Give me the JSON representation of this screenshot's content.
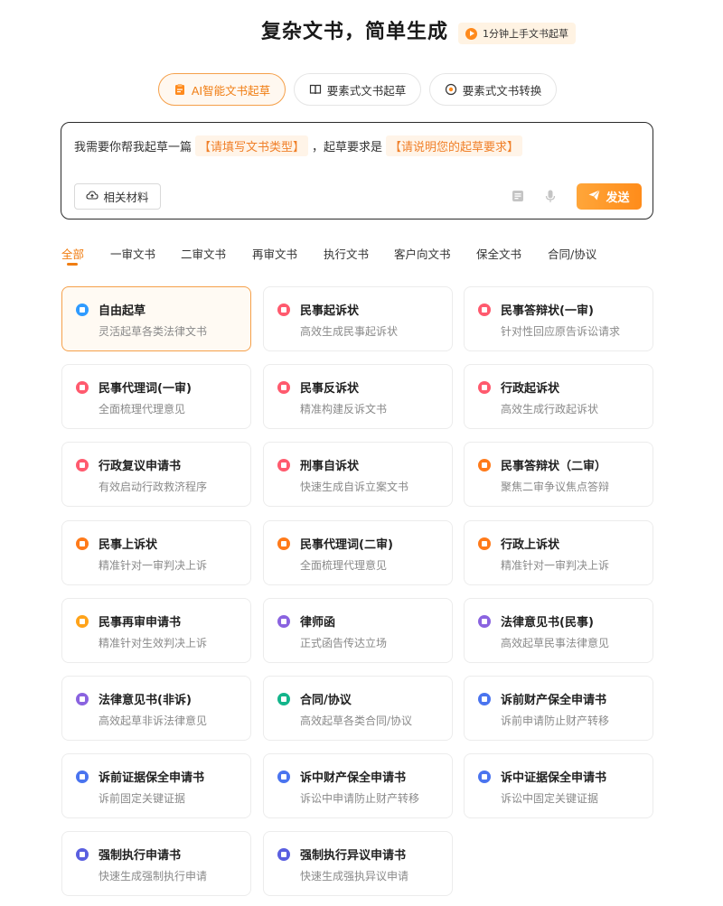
{
  "header": {
    "title": "复杂文书，简单生成",
    "tutorial_label": "1分钟上手文书起草",
    "tutorial_icon": "play-icon"
  },
  "modes": [
    {
      "label": "AI智能文书起草",
      "icon": "clipboard-icon",
      "active": true
    },
    {
      "label": "要素式文书起草",
      "icon": "book-icon",
      "active": false
    },
    {
      "label": "要素式文书转换",
      "icon": "convert-icon",
      "active": false
    }
  ],
  "composer": {
    "prefix": "我需要你帮我起草一篇",
    "doc_type_slot": "【请填写文书类型】",
    "middle": "，起草要求是",
    "requirement_slot": "【请说明您的起草要求】",
    "materials_label": "相关材料",
    "send_label": "发送"
  },
  "categories": [
    "全部",
    "一审文书",
    "二审文书",
    "再审文书",
    "执行文书",
    "客户向文书",
    "保全文书",
    "合同/协议"
  ],
  "cards": [
    {
      "title": "自由起草",
      "desc": "灵活起草各类法律文书",
      "icon_color": "#2f9bff"
    },
    {
      "title": "民事起诉状",
      "desc": "高效生成民事起诉状",
      "icon_color": "#ff5a6e"
    },
    {
      "title": "民事答辩状(一审)",
      "desc": "针对性回应原告诉讼请求",
      "icon_color": "#ff5a6e"
    },
    {
      "title": "民事代理词(一审)",
      "desc": "全面梳理代理意见",
      "icon_color": "#ff5a6e"
    },
    {
      "title": "民事反诉状",
      "desc": "精准构建反诉文书",
      "icon_color": "#ff5a6e"
    },
    {
      "title": "行政起诉状",
      "desc": "高效生成行政起诉状",
      "icon_color": "#ff5a6e"
    },
    {
      "title": "行政复议申请书",
      "desc": "有效启动行政救济程序",
      "icon_color": "#ff5a6e"
    },
    {
      "title": "刑事自诉状",
      "desc": "快速生成自诉立案文书",
      "icon_color": "#ff5a6e"
    },
    {
      "title": "民事答辩状（二审）",
      "desc": "聚焦二审争议焦点答辩",
      "icon_color": "#ff7a1a"
    },
    {
      "title": "民事上诉状",
      "desc": "精准针对一审判决上诉",
      "icon_color": "#ff7a1a"
    },
    {
      "title": "民事代理词(二审)",
      "desc": "全面梳理代理意见",
      "icon_color": "#ff7a1a"
    },
    {
      "title": "行政上诉状",
      "desc": "精准针对一审判决上诉",
      "icon_color": "#ff7a1a"
    },
    {
      "title": "民事再审申请书",
      "desc": "精准针对生效判决上诉",
      "icon_color": "#ffa31a"
    },
    {
      "title": "律师函",
      "desc": "正式函告传达立场",
      "icon_color": "#8a63e0"
    },
    {
      "title": "法律意见书(民事)",
      "desc": "高效起草民事法律意见",
      "icon_color": "#8a63e0"
    },
    {
      "title": "法律意见书(非诉)",
      "desc": "高效起草非诉法律意见",
      "icon_color": "#8a63e0"
    },
    {
      "title": "合同/协议",
      "desc": "高效起草各类合同/协议",
      "icon_color": "#13b58b"
    },
    {
      "title": "诉前财产保全申请书",
      "desc": "诉前申请防止财产转移",
      "icon_color": "#4a74ef"
    },
    {
      "title": "诉前证据保全申请书",
      "desc": "诉前固定关键证据",
      "icon_color": "#4a74ef"
    },
    {
      "title": "诉中财产保全申请书",
      "desc": "诉讼中申请防止财产转移",
      "icon_color": "#4a74ef"
    },
    {
      "title": "诉中证据保全申请书",
      "desc": "诉讼中固定关键证据",
      "icon_color": "#4a74ef"
    },
    {
      "title": "强制执行申请书",
      "desc": "快速生成强制执行申请",
      "icon_color": "#5a5fe0"
    },
    {
      "title": "强制执行异议申请书",
      "desc": "快速生成强执异议申请",
      "icon_color": "#5a5fe0"
    }
  ]
}
